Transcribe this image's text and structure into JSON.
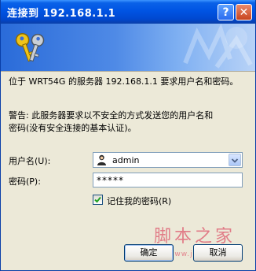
{
  "window": {
    "title": "连接到 192.168.1.1",
    "help_label": "?",
    "close_label": "✕"
  },
  "banner": {
    "icon": "keys-icon",
    "watermark_icon": "globe-icon"
  },
  "message": {
    "line1": "位于 WRT54G 的服务器 192.168.1.1 要求用户名和密码。",
    "warning_line1": "警告: 此服务器要求以不安全的方式发送您的用户名和",
    "warning_line2": "密码(没有安全连接的基本认证)。"
  },
  "form": {
    "username_label": "用户名(U):",
    "username_value": "admin",
    "password_label": "密码(P):",
    "password_value": "*****",
    "remember_label": "记住我的密码(R)",
    "remember_checked": true
  },
  "buttons": {
    "ok_label": "确定",
    "cancel_label": "取消"
  },
  "watermark": {
    "text": "脚本之家",
    "url": "www.jb51.net"
  }
}
